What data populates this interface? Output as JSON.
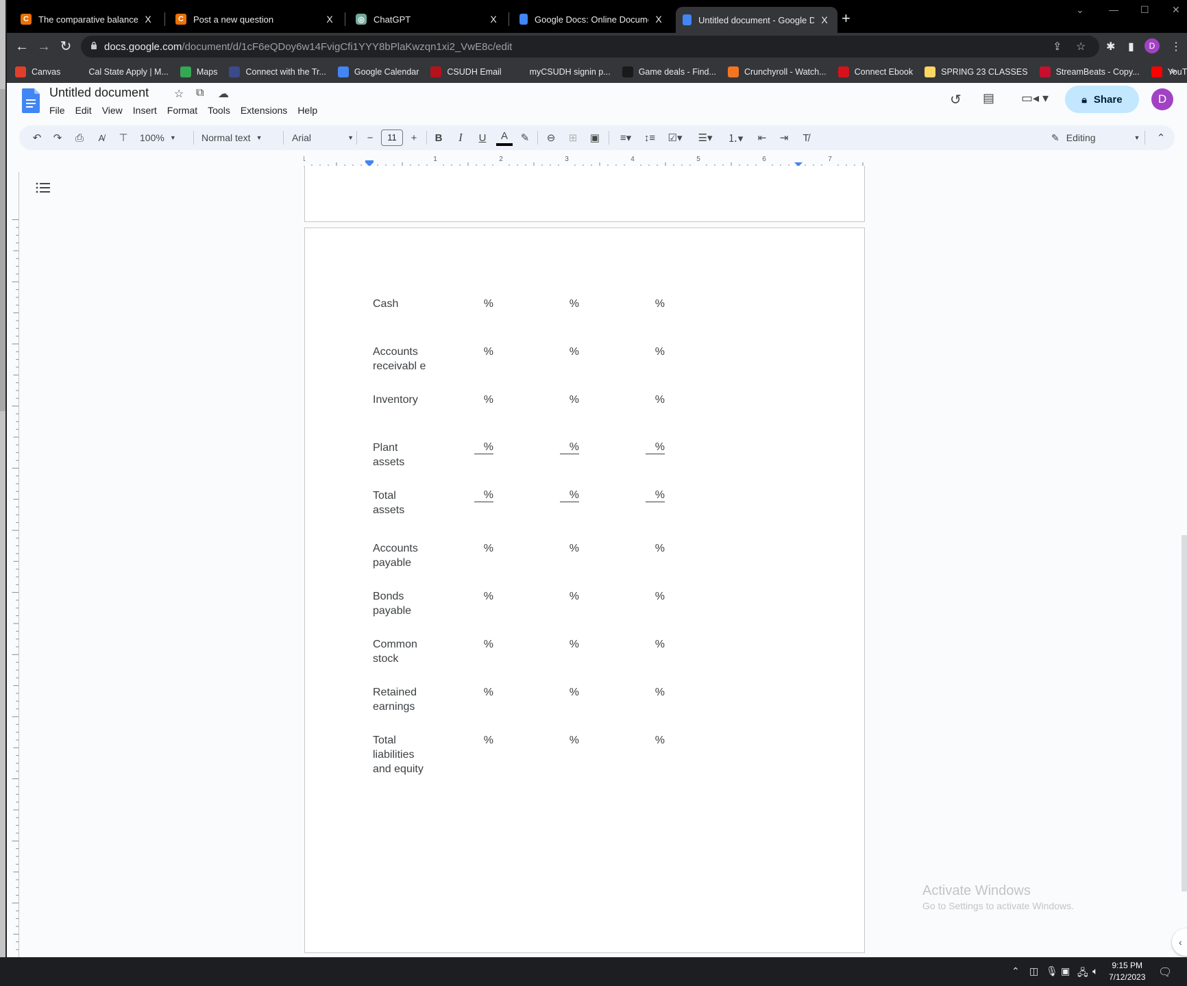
{
  "browser": {
    "tabs": [
      {
        "title": "The comparative balance sheets f",
        "favicon": "chegg-icon",
        "active": false
      },
      {
        "title": "Post a new question",
        "favicon": "chegg-icon",
        "active": false
      },
      {
        "title": "ChatGPT",
        "favicon": "chatgpt-icon",
        "active": false
      },
      {
        "title": "Google Docs: Online Document E",
        "favicon": "google-docs-icon",
        "active": false
      },
      {
        "title": "Untitled document - Google Doc",
        "favicon": "google-docs-icon",
        "active": true
      }
    ],
    "new_tab_label": "+",
    "close_glyph": "X",
    "url_host": "docs.google.com",
    "url_path": "/document/d/1cF6eQDoy6w14FvigCfi1YYY8bPlaKwzqn1xi2_VwE8c/edit",
    "profile_initial": "D",
    "bookmarks": [
      {
        "label": "Canvas",
        "icon": "canvas-icon",
        "color": "#e13f2b"
      },
      {
        "label": "Cal State Apply | M...",
        "icon": "globe-icon",
        "color": "#35363a"
      },
      {
        "label": "Maps",
        "icon": "maps-icon",
        "color": "#34a853"
      },
      {
        "label": "Connect with the Tr...",
        "icon": "seal-icon",
        "color": "#3b4a8a"
      },
      {
        "label": "Google Calendar",
        "icon": "calendar-icon",
        "color": "#4285f4"
      },
      {
        "label": "CSUDH Email",
        "icon": "csudh-icon",
        "color": "#b5121b"
      },
      {
        "label": "myCSUDH signin p...",
        "icon": "globe-icon",
        "color": "#35363a"
      },
      {
        "label": "Game deals - Find...",
        "icon": "gg-icon",
        "color": "#1a1a1a"
      },
      {
        "label": "Crunchyroll - Watch...",
        "icon": "crunchyroll-icon",
        "color": "#f47521"
      },
      {
        "label": "Connect Ebook",
        "icon": "mcgraw-hill-icon",
        "color": "#d5121b"
      },
      {
        "label": "SPRING 23 CLASSES",
        "icon": "folder-icon",
        "color": "#fdd663"
      },
      {
        "label": "StreamBeats - Copy...",
        "icon": "streambeats-icon",
        "color": "#c8102e"
      },
      {
        "label": "YouTube",
        "icon": "youtube-icon",
        "color": "#ff0000"
      }
    ],
    "bookmarks_overflow": "»"
  },
  "docs": {
    "title": "Untitled document",
    "menu": [
      "File",
      "Edit",
      "View",
      "Insert",
      "Format",
      "Tools",
      "Extensions",
      "Help"
    ],
    "share_label": "Share",
    "account_initial": "D",
    "toolbar": {
      "zoom": "100%",
      "style": "Normal text",
      "font": "Arial",
      "font_size": "11",
      "mode": "Editing"
    },
    "ruler_h": [
      "1",
      "1",
      "2",
      "3",
      "4",
      "5",
      "6",
      "7"
    ],
    "table_rows": [
      {
        "label": "Cash",
        "values": [
          "%",
          "%",
          "%"
        ],
        "underlined": false
      },
      {
        "label": "Accounts receivabl e",
        "values": [
          "%",
          "%",
          "%"
        ],
        "underlined": false
      },
      {
        "label": "Inventory",
        "values": [
          "%",
          "%",
          "%"
        ],
        "underlined": false
      },
      {
        "label": "Plant assets",
        "values": [
          "%",
          "%",
          "%"
        ],
        "underlined": true
      },
      {
        "label": "Total assets",
        "values": [
          "%",
          "%",
          "%"
        ],
        "underlined": true
      },
      {
        "label": "Accounts payable",
        "values": [
          "%",
          "%",
          "%"
        ],
        "underlined": false
      },
      {
        "label": "Bonds payable",
        "values": [
          "%",
          "%",
          "%"
        ],
        "underlined": false
      },
      {
        "label": "Common stock",
        "values": [
          "%",
          "%",
          "%"
        ],
        "underlined": false
      },
      {
        "label": "Retained earnings",
        "values": [
          "%",
          "%",
          "%"
        ],
        "underlined": false
      },
      {
        "label": "Total liabilities and equity",
        "values": [
          "%",
          "%",
          "%"
        ],
        "underlined": false
      }
    ]
  },
  "watermark": {
    "title": "Activate Windows",
    "subtitle": "Go to Settings to activate Windows."
  },
  "taskbar": {
    "time": "9:15 PM",
    "date": "7/12/2023"
  },
  "colors": {
    "share_bg": "#c2e7ff",
    "accent_blue": "#4285f4",
    "account_purple": "#a142c4"
  }
}
